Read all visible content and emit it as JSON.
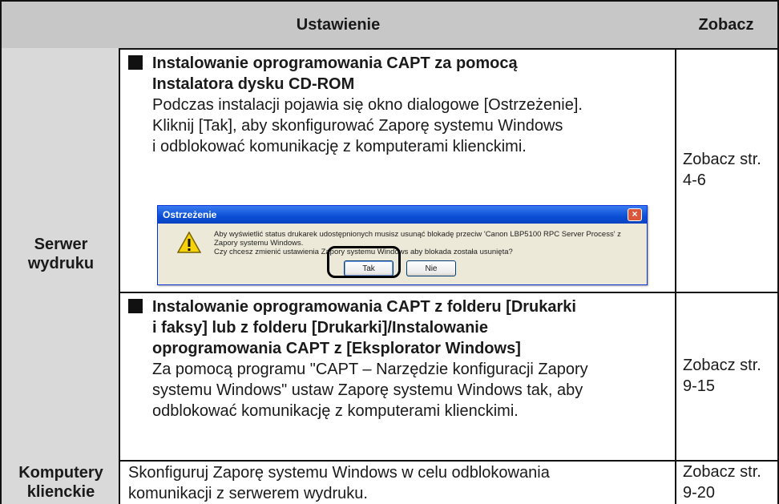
{
  "header": {
    "setting": "Ustawienie",
    "see": "Zobacz"
  },
  "rows": {
    "server_label": "Serwer\nwydruku",
    "clients_label": "Komputery\nklienckie"
  },
  "section1": {
    "title_line1": "Instalowanie oprogramowania CAPT za pomocą",
    "title_line2": "Instalatora dysku CD-ROM",
    "text_line1": "Podczas instalacji pojawia się okno dialogowe [Ostrzeżenie].",
    "text_line2": "Kliknij [Tak], aby skonfigurować Zaporę systemu Windows",
    "text_line3": "i odblokować komunikację z komputerami klienckimi.",
    "see": "Zobacz str.\n4-6"
  },
  "dialog": {
    "title": "Ostrzeżenie",
    "msg_line1": "Aby wyświetlić status drukarek udostępnionych musisz usunąć blokadę przeciw 'Canon LBP5100 RPC Server Process' z",
    "msg_line2": "Zapory systemu Windows.",
    "msg_line3": "Czy chcesz zmienić ustawienia Zapory systemu Windows aby blokada została usunięta?",
    "yes_label": "Tak",
    "no_label": "Nie",
    "close_glyph": "×",
    "icon": "warning-icon"
  },
  "section2": {
    "title_line1": "Instalowanie oprogramowania CAPT z folderu [Drukarki",
    "title_line2": "i faksy] lub z folderu [Drukarki]/Instalowanie",
    "title_line3": "oprogramowania CAPT z [Eksplorator Windows]",
    "text_line1": "Za pomocą programu \"CAPT – Narzędzie konfiguracji Zapory",
    "text_line2": "systemu Windows\" ustaw Zaporę systemu Windows tak, aby",
    "text_line3": "odblokować komunikację z komputerami klienckimi.",
    "see": "Zobacz str.\n9-15"
  },
  "section3": {
    "text_line1": "Skonfiguruj Zaporę systemu Windows w celu odblokowania",
    "text_line2": "komunikacji z serwerem wydruku.",
    "see": "Zobacz str.\n9-20"
  }
}
